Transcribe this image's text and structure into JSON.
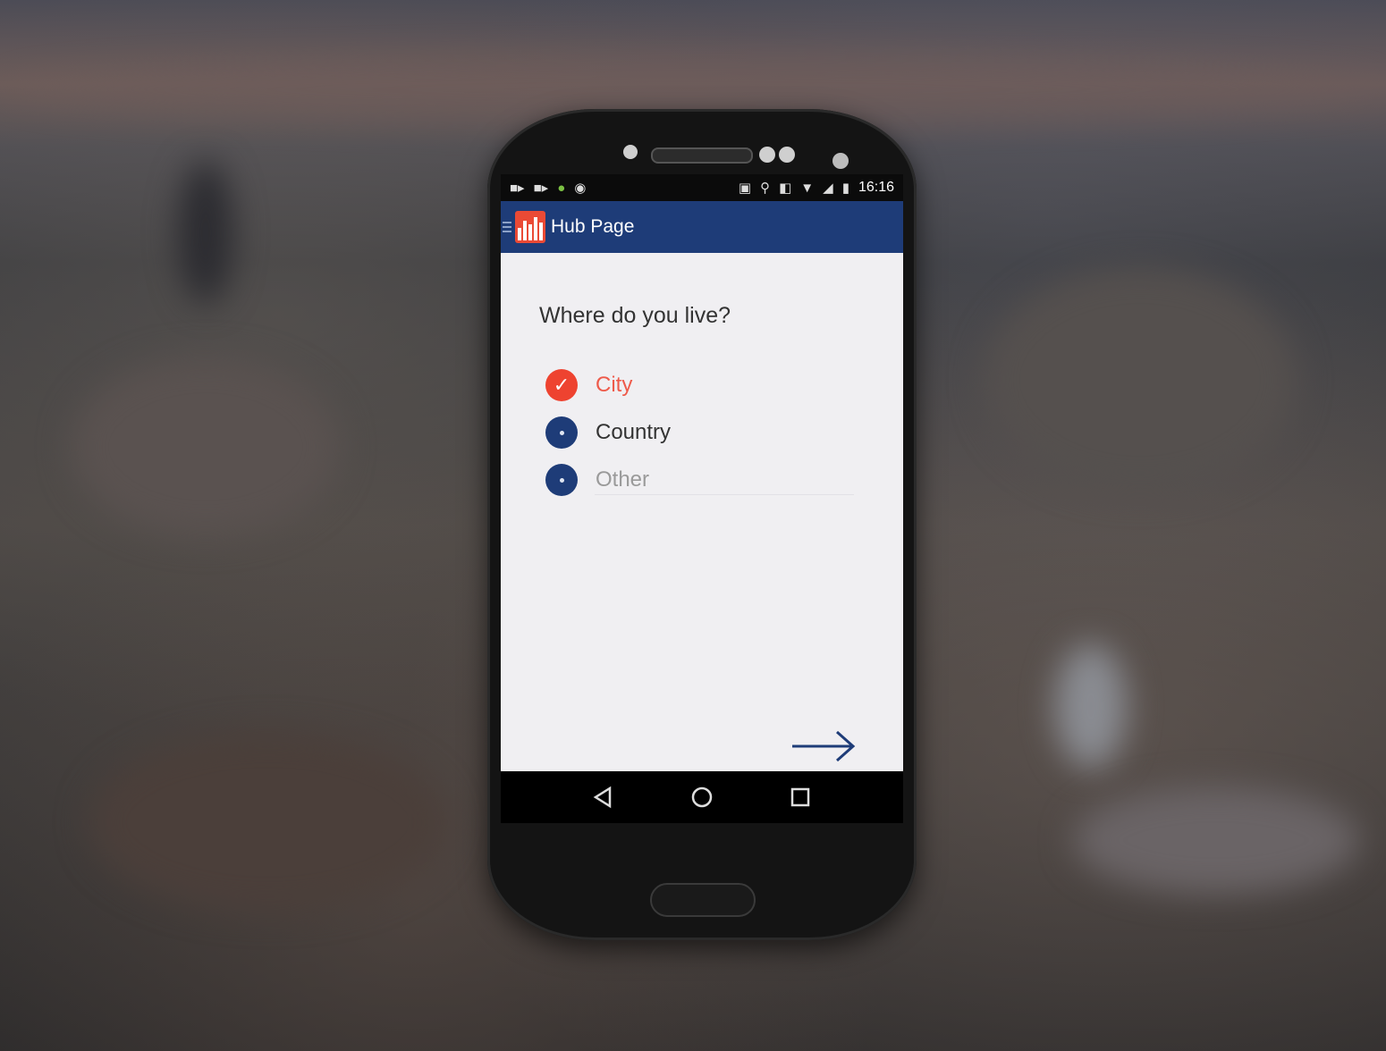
{
  "status_bar": {
    "time": "16:16",
    "left_icons": [
      "video-icon",
      "video-icon",
      "android-icon",
      "chat-icon"
    ],
    "right_icons": [
      "cast-icon",
      "location-icon",
      "vibrate-icon",
      "wifi-icon",
      "signal-icon",
      "battery-icon"
    ]
  },
  "app_bar": {
    "title": "Hub Page"
  },
  "survey": {
    "question": "Where do you live?",
    "options": [
      {
        "label": "City",
        "selected": true
      },
      {
        "label": "Country",
        "selected": false
      },
      {
        "label": "Other",
        "selected": false
      }
    ]
  },
  "colors": {
    "primary": "#1e3c78",
    "accent": "#ee4330",
    "screen_bg": "#f0eff2"
  },
  "nav_bar": {
    "icons": [
      "back-icon",
      "home-icon",
      "recents-icon"
    ]
  }
}
